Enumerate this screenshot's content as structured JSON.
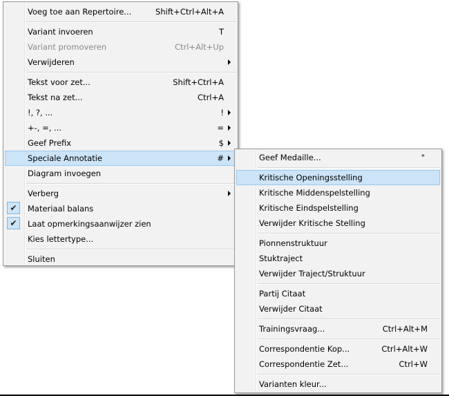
{
  "main_menu": {
    "items": [
      {
        "label": "Voeg toe aan Repertoire...",
        "shortcut": "Shift+Ctrl+Alt+A"
      },
      {
        "label": "Variant invoeren",
        "shortcut": "T"
      },
      {
        "label": "Variant promoveren",
        "shortcut": "Ctrl+Alt+Up"
      },
      {
        "label": "Verwijderen"
      },
      {
        "label": "Tekst voor zet...",
        "shortcut": "Shift+Ctrl+A"
      },
      {
        "label": "Tekst na zet...",
        "shortcut": "Ctrl+A"
      },
      {
        "label": "!, ?, ...",
        "shortcut": "!"
      },
      {
        "label": "+-, =, ...",
        "shortcut": "="
      },
      {
        "label": "Geef Prefix",
        "shortcut": "$"
      },
      {
        "label": "Speciale Annotatie",
        "shortcut": "#"
      },
      {
        "label": "Diagram invoegen"
      },
      {
        "label": "Verberg"
      },
      {
        "label": "Materiaal balans"
      },
      {
        "label": "Laat opmerkingsaanwijzer zien"
      },
      {
        "label": "Kies lettertype..."
      },
      {
        "label": "Sluiten"
      }
    ]
  },
  "sub_menu": {
    "items": [
      {
        "label": "Geef Medaille...",
        "shortcut": "\""
      },
      {
        "label": "Kritische Openingsstelling"
      },
      {
        "label": "Kritische Middenspelstelling"
      },
      {
        "label": "Kritische Eindspelstelling"
      },
      {
        "label": "Verwijder Kritische Stelling"
      },
      {
        "label": "Pionnenstruktuur"
      },
      {
        "label": "Stuktraject"
      },
      {
        "label": "Verwijder Traject/Struktuur"
      },
      {
        "label": "Partij Citaat"
      },
      {
        "label": "Verwijder Citaat"
      },
      {
        "label": "Trainingsvraag...",
        "shortcut": "Ctrl+Alt+M"
      },
      {
        "label": "Correspondentie Kop...",
        "shortcut": "Ctrl+Alt+W"
      },
      {
        "label": "Correspondentie Zet...",
        "shortcut": "Ctrl+W"
      },
      {
        "label": "Varianten kleur..."
      }
    ]
  },
  "icons": {
    "check": "checkmark-icon",
    "submenu_arrow": "chevron-right-icon"
  },
  "colors": {
    "menu_bg": "#f2f2f2",
    "highlight": "#cce4f7",
    "highlight_border": "#99c9ef",
    "disabled_text": "#8a8a8a"
  }
}
